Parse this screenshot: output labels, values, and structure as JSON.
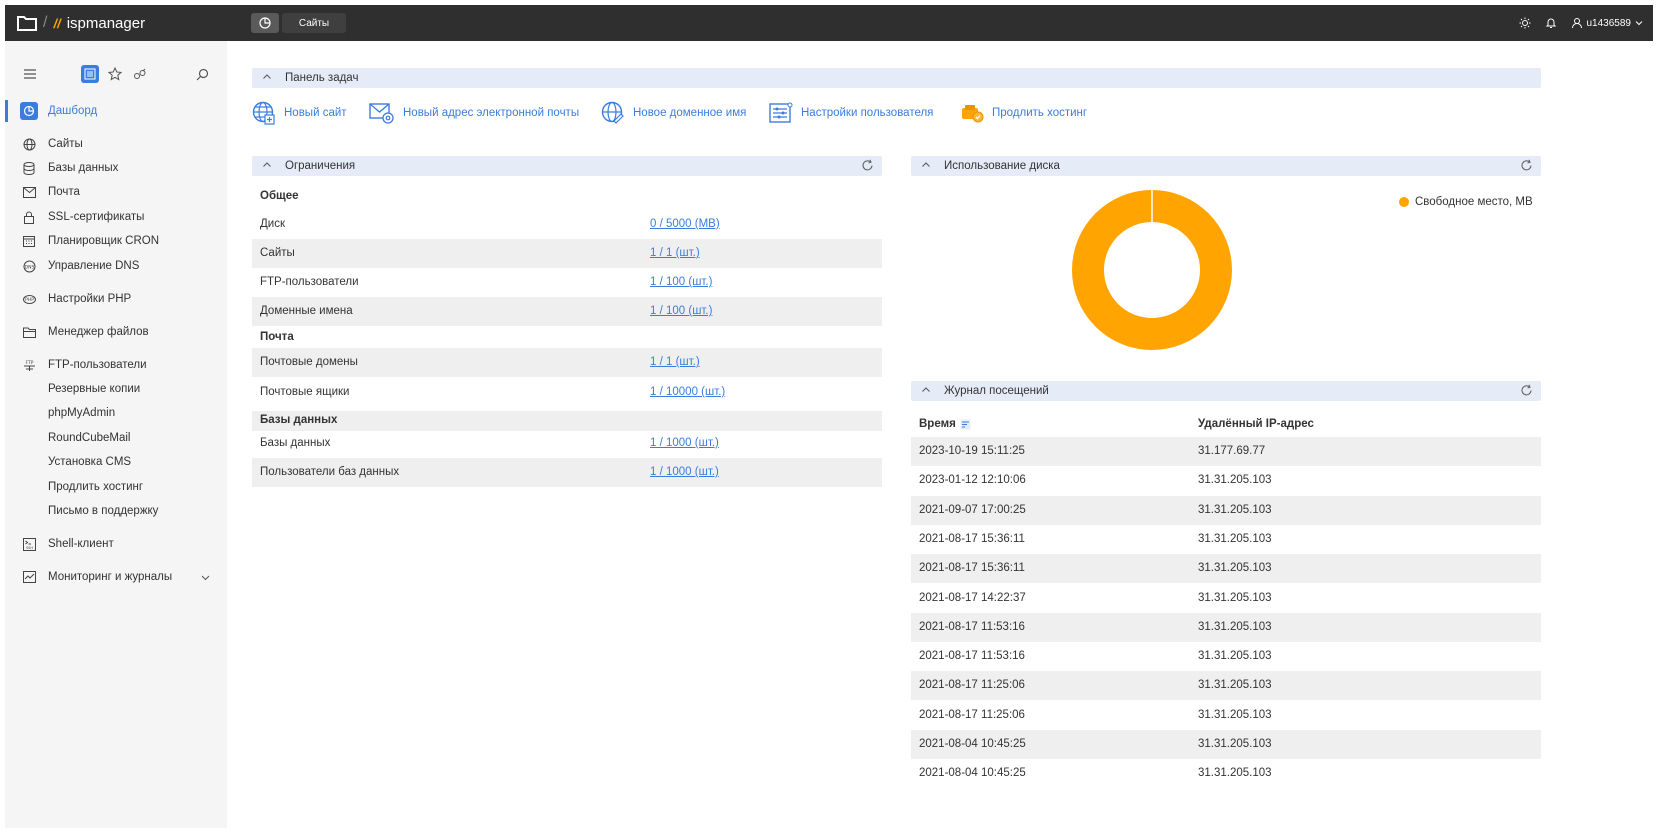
{
  "app": {
    "brand": "ispmanager",
    "top_tab": "Сайты",
    "username": "u1436589"
  },
  "sidebar": {
    "items": [
      {
        "label": "Дашборд",
        "icon": "dashboard-icon"
      },
      {
        "label": "Сайты",
        "icon": "globe-icon"
      },
      {
        "label": "Базы данных",
        "icon": "database-icon"
      },
      {
        "label": "Почта",
        "icon": "mail-icon"
      },
      {
        "label": "SSL-сертификаты",
        "icon": "lock-icon"
      },
      {
        "label": "Планировщик CRON",
        "icon": "calendar-icon"
      },
      {
        "label": "Управление DNS",
        "icon": "dns-icon"
      },
      {
        "label": "Настройки PHP",
        "icon": "php-icon"
      },
      {
        "label": "Менеджер файлов",
        "icon": "folder-icon"
      },
      {
        "label": "FTP-пользователи",
        "icon": "ftp-icon"
      },
      {
        "label": "Резервные копии"
      },
      {
        "label": "phpMyAdmin"
      },
      {
        "label": "RoundCubeMail"
      },
      {
        "label": "Установка CMS"
      },
      {
        "label": "Продлить хостинг"
      },
      {
        "label": "Письмо в поддержку"
      },
      {
        "label": "Shell-клиент",
        "icon": "terminal-icon"
      },
      {
        "label": "Мониторинг и журналы",
        "icon": "monitoring-icon"
      }
    ]
  },
  "taskbar": {
    "title": "Панель задач",
    "actions": [
      {
        "label": "Новый сайт"
      },
      {
        "label": "Новый адрес электронной почты"
      },
      {
        "label": "Новое доменное имя"
      },
      {
        "label": "Настройки пользователя"
      },
      {
        "label": "Продлить хостинг"
      }
    ]
  },
  "limits": {
    "title": "Ограничения",
    "groups": [
      {
        "name": "Общее",
        "rows": [
          {
            "key": "Диск",
            "value": "0 / 5000 (MB)"
          },
          {
            "key": "Сайты",
            "value": "1 / 1 (шт.)"
          },
          {
            "key": "FTP-пользователи",
            "value": "1 / 100 (шт.)"
          },
          {
            "key": "Доменные имена",
            "value": "1 / 100 (шт.)"
          }
        ]
      },
      {
        "name": "Почта",
        "rows": [
          {
            "key": "Почтовые домены",
            "value": "1 / 1 (шт.)"
          },
          {
            "key": "Почтовые ящики",
            "value": "1 / 10000 (шт.)"
          }
        ]
      },
      {
        "name": "Базы данных",
        "rows": [
          {
            "key": "Базы данных",
            "value": "1 / 1000 (шт.)"
          },
          {
            "key": "Пользователи баз данных",
            "value": "1 / 1000 (шт.)"
          }
        ]
      }
    ]
  },
  "disk": {
    "title": "Использование диска"
  },
  "chart_data": {
    "type": "pie",
    "categories": [
      "Свободное место, MB"
    ],
    "values": [
      5000
    ],
    "colors": [
      "#ffa400"
    ],
    "donut": true,
    "legend": "top-right"
  },
  "visits": {
    "title": "Журнал посещений",
    "columns": [
      "Время",
      "Удалённый IP-адрес"
    ],
    "rows": [
      [
        "2023-10-19 15:11:25",
        "31.177.69.77"
      ],
      [
        "2023-01-12 12:10:06",
        "31.31.205.103"
      ],
      [
        "2021-09-07 17:00:25",
        "31.31.205.103"
      ],
      [
        "2021-08-17 15:36:11",
        "31.31.205.103"
      ],
      [
        "2021-08-17 15:36:11",
        "31.31.205.103"
      ],
      [
        "2021-08-17 14:22:37",
        "31.31.205.103"
      ],
      [
        "2021-08-17 11:53:16",
        "31.31.205.103"
      ],
      [
        "2021-08-17 11:53:16",
        "31.31.205.103"
      ],
      [
        "2021-08-17 11:25:06",
        "31.31.205.103"
      ],
      [
        "2021-08-17 11:25:06",
        "31.31.205.103"
      ],
      [
        "2021-08-04 10:45:25",
        "31.31.205.103"
      ],
      [
        "2021-08-04 10:45:25",
        "31.31.205.103"
      ]
    ]
  },
  "colors": {
    "accent": "#3b7ddd",
    "chart": "#ffa400",
    "topbar": "#2f2f2f",
    "section_header": "#e5ecf8"
  }
}
